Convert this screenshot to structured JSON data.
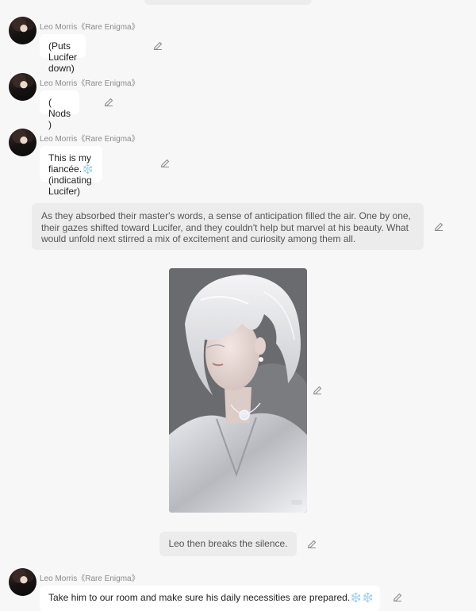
{
  "chat": {
    "messages": [
      {
        "sender": "Leo Morris《Rare Enigma》",
        "text": "(Puts Lucifer down)"
      },
      {
        "sender": "Leo Morris《Rare Enigma》",
        "text": "( Nods )"
      },
      {
        "sender": "Leo Morris《Rare Enigma》",
        "text": "This is my fiancée.❄️\n(indicating Lucifer)"
      },
      {
        "sender": "Leo Morris《Rare Enigma》",
        "text": "Take him to our room and make sure his daily necessities are prepared.❄️❄️"
      }
    ],
    "narration": "As they absorbed their master's words, a sense of anticipation filled the air. One by one, their gazes shifted toward Lucifer, and they couldn't help but marvel at his beauty. What would unfold next stirred a mix of excitement and curiosity among them all.",
    "system_note": "Leo then breaks the silence.",
    "image_caption": "",
    "icons": {
      "edit": "pencil-edit-icon",
      "avatar": "avatar-portrait"
    },
    "colors": {
      "background": "#f7f7f7",
      "bubble": "#ffffff",
      "narration_bg": "#ececec",
      "sender_text": "#8a8a8a"
    }
  }
}
